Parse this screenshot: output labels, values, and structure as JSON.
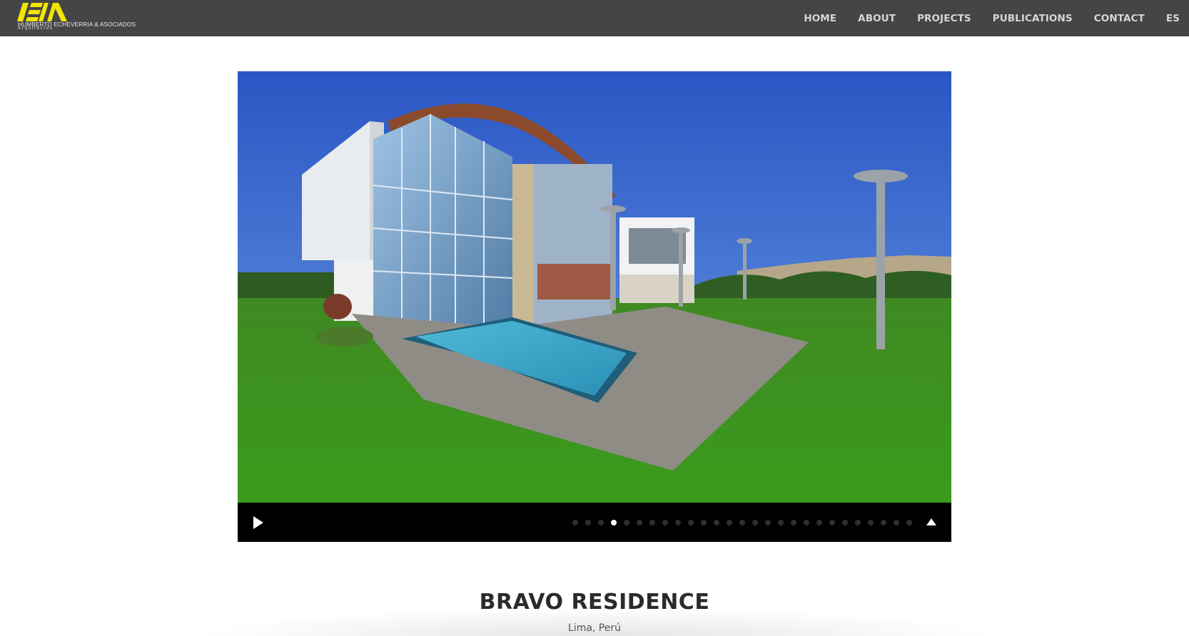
{
  "header": {
    "logo": {
      "line1": "HUMBERTO ECHEVERRIA & ASOCIADOS",
      "line2": "Arquitectos",
      "accent_color": "#f2e500"
    },
    "nav": [
      "HOME",
      "ABOUT",
      "PROJECTS",
      "PUBLICATIONS",
      "CONTACT",
      "ES"
    ]
  },
  "slider": {
    "total_slides": 27,
    "active_index": 3,
    "image_semantic": "modern glass house with swimming pool and lawn",
    "play_icon": "play-icon",
    "collapse_icon": "triangle-up-icon"
  },
  "project": {
    "title": "BRAVO RESIDENCE",
    "location": "Lima, Perú"
  }
}
